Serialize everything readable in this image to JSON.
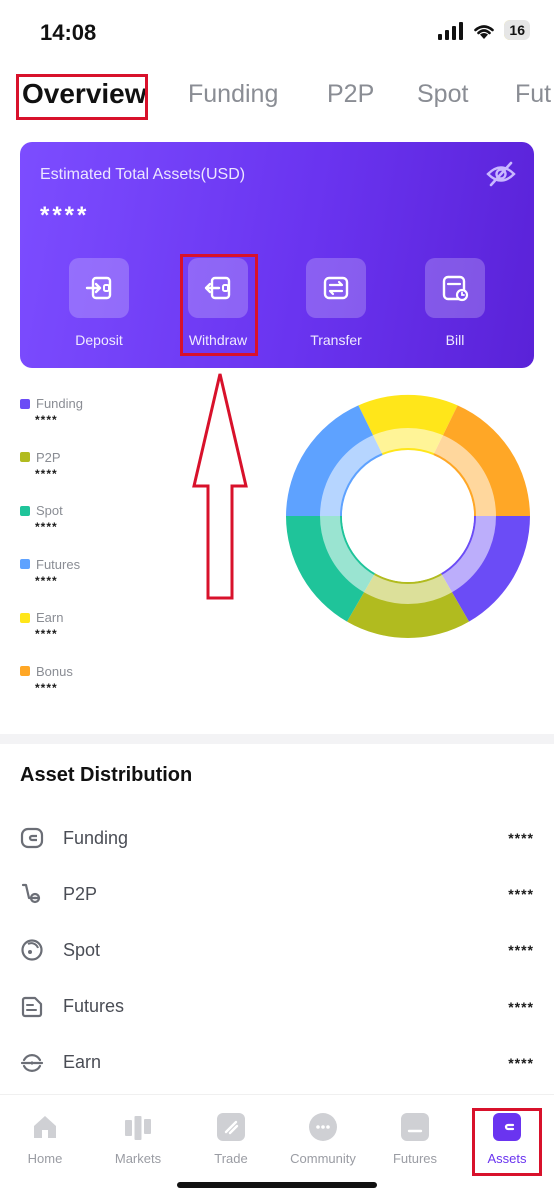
{
  "status": {
    "time": "14:08",
    "battery": "16"
  },
  "tabs": [
    {
      "label": "Overview"
    },
    {
      "label": "Funding"
    },
    {
      "label": "P2P"
    },
    {
      "label": "Spot"
    },
    {
      "label": "Fut"
    }
  ],
  "card": {
    "title": "Estimated Total Assets(USD)",
    "value": "****",
    "actions": [
      {
        "label": "Deposit",
        "icon": "deposit-icon"
      },
      {
        "label": "Withdraw",
        "icon": "withdraw-icon"
      },
      {
        "label": "Transfer",
        "icon": "transfer-icon"
      },
      {
        "label": "Bill",
        "icon": "bill-icon"
      }
    ]
  },
  "legend": [
    {
      "name": "Funding",
      "value": "****",
      "color": "#6b4cf6"
    },
    {
      "name": "P2P",
      "value": "****",
      "color": "#b1bb1f"
    },
    {
      "name": "Spot",
      "value": "****",
      "color": "#1fc49a"
    },
    {
      "name": "Futures",
      "value": "****",
      "color": "#5ea2ff"
    },
    {
      "name": "Earn",
      "value": "****",
      "color": "#ffe61a"
    },
    {
      "name": "Bonus",
      "value": "****",
      "color": "#ffa726"
    }
  ],
  "distribution": {
    "title": "Asset Distribution",
    "rows": [
      {
        "name": "Funding",
        "value": "****",
        "icon": "wallet-icon"
      },
      {
        "name": "P2P",
        "value": "****",
        "icon": "p2p-icon"
      },
      {
        "name": "Spot",
        "value": "****",
        "icon": "spot-icon"
      },
      {
        "name": "Futures",
        "value": "****",
        "icon": "futures-icon"
      },
      {
        "name": "Earn",
        "value": "****",
        "icon": "earn-icon"
      }
    ]
  },
  "nav": [
    {
      "label": "Home",
      "icon": "home-icon"
    },
    {
      "label": "Markets",
      "icon": "markets-icon"
    },
    {
      "label": "Trade",
      "icon": "trade-icon"
    },
    {
      "label": "Community",
      "icon": "community-icon"
    },
    {
      "label": "Futures",
      "icon": "futures-nav-icon"
    },
    {
      "label": "Assets",
      "icon": "assets-icon"
    }
  ],
  "colors": {
    "accent": "#6a34f0",
    "annotation": "#d8112b"
  }
}
